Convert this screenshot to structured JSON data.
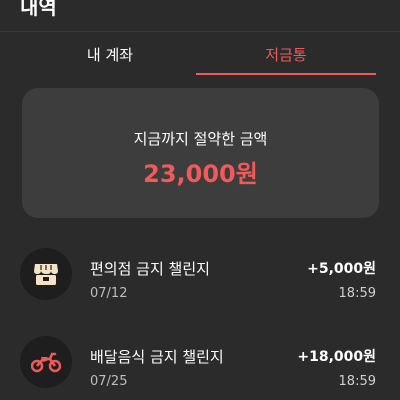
{
  "header": {
    "title": "내역"
  },
  "tabs": [
    {
      "label": "내 계좌",
      "active": false
    },
    {
      "label": "저금통",
      "active": true
    }
  ],
  "summary": {
    "label": "지금까지 절약한 금액",
    "amount": "23,000원"
  },
  "items": [
    {
      "icon": "store-icon",
      "title": "편의점 금지 챌린지",
      "date": "07/12",
      "amount": "+5,000원",
      "time": "18:59"
    },
    {
      "icon": "motorcycle-icon",
      "title": "배달음식 금지 챌린지",
      "date": "07/25",
      "amount": "+18,000원",
      "time": "18:59"
    }
  ],
  "colors": {
    "accent": "#f05a5a",
    "background": "#2b2b2b",
    "card": "#3d3d3d",
    "icon_bg": "#1e1e1e",
    "store_icon": "#f7e3c4"
  }
}
